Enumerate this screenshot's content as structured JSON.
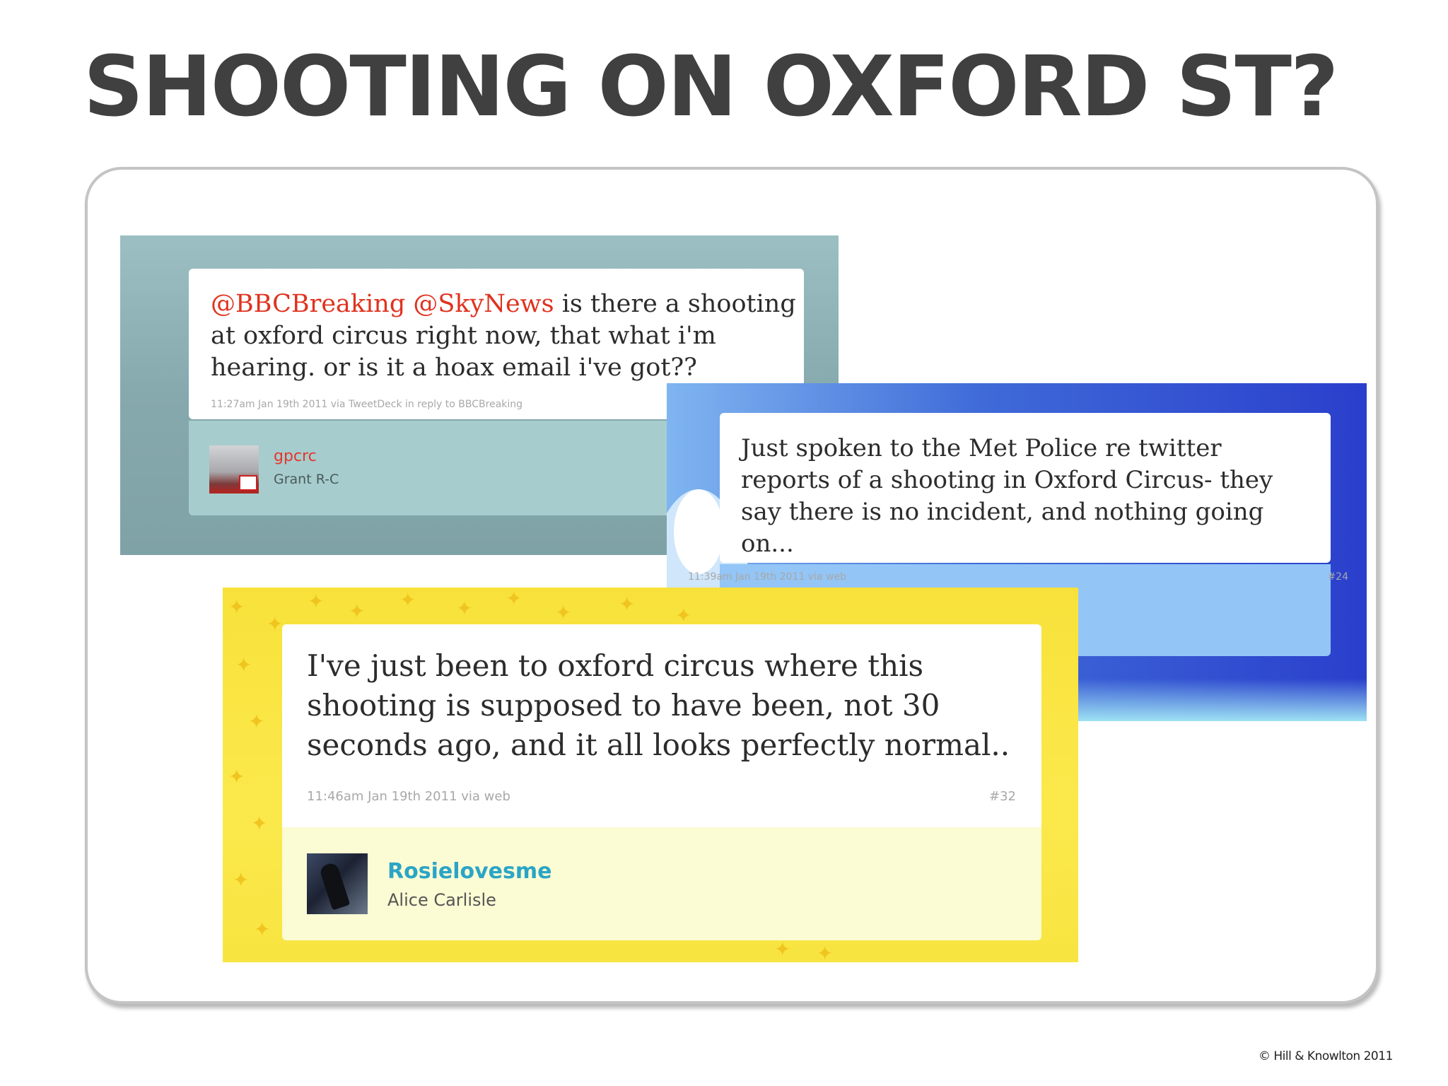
{
  "slide": {
    "title": "SHOOTING ON OXFORD ST?",
    "copyright": "© Hill & Knowlton 2011"
  },
  "tweets": [
    {
      "mention1": "@BBCBreaking",
      "mention2": "@SkyNews",
      "text": " is there a shooting at oxford circus right now, that what i'm hearing. or is it a hoax email i've got??",
      "meta": "11:27am Jan 19th 2011 via TweetDeck in reply to BBCBreaking",
      "username": "gpcrc",
      "real_name": "Grant R-C"
    },
    {
      "text": "Just spoken to the Met Police re twitter reports of a shooting in Oxford Circus- they say there is no incident, and nothing going on...",
      "meta": "11:39am Jan 19th 2011 via web",
      "number": "#24"
    },
    {
      "text": "I've just been to oxford circus where this shooting is supposed to have been, not 30 seconds ago, and it all looks perfectly normal..",
      "meta": "11:46am Jan 19th 2011 via web",
      "number": "#32",
      "username": "Rosielovesme",
      "real_name": "Alice Carlisle"
    }
  ],
  "colors": {
    "title": "#404040",
    "mention": "#e0321e",
    "username_gpcrc": "#e5362d",
    "username_rosie": "#2aa5c6",
    "shot1_bg": "#8fb3b7",
    "shot2_bg": "#3f6ad8",
    "shot3_bg": "#f8e13a"
  },
  "icons": [
    "avatar-photo",
    "england-flag",
    "avatar-photo"
  ]
}
